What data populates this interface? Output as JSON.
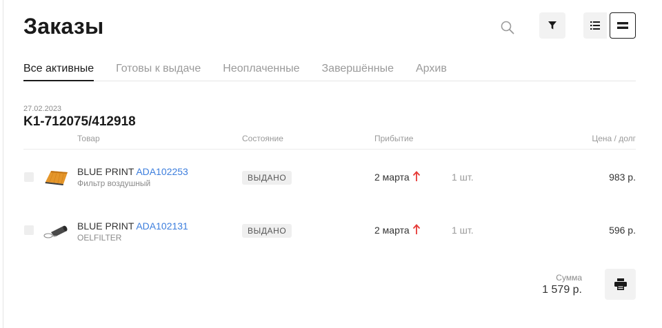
{
  "page": {
    "title": "Заказы"
  },
  "toolbar": {
    "search_icon": "search-icon",
    "filter_icon": "filter-icon",
    "list_view_icon": "list-view-icon",
    "compact_view_icon": "compact-view-icon"
  },
  "tabs": [
    {
      "label": "Все активные",
      "active": true
    },
    {
      "label": "Готовы к выдаче",
      "active": false
    },
    {
      "label": "Неоплаченные",
      "active": false
    },
    {
      "label": "Завершённые",
      "active": false
    },
    {
      "label": "Архив",
      "active": false
    }
  ],
  "order": {
    "date": "27.02.2023",
    "number": "K1-712075/412918",
    "columns": {
      "product": "Товар",
      "state": "Состояние",
      "arrival": "Прибытие",
      "price": "Цена / долг"
    },
    "items": [
      {
        "brand": "BLUE PRINT",
        "article": "ADA102253",
        "description": "Фильтр воздушный",
        "status": "ВЫДАНО",
        "arrival": "2 марта",
        "quantity": "1 шт.",
        "price": "983 р.",
        "thumb_icon": "air-filter-icon"
      },
      {
        "brand": "BLUE PRINT",
        "article": "ADA102131",
        "description": "OELFILTER",
        "status": "ВЫДАНО",
        "arrival": "2 марта",
        "quantity": "1 шт.",
        "price": "596 р.",
        "thumb_icon": "oil-filter-icon"
      }
    ],
    "total": {
      "label": "Сумма",
      "value": "1 579 р."
    }
  },
  "colors": {
    "accent_link": "#3b7ddd",
    "arrival_arrow": "#e53935",
    "text_primary": "#1a1a1a",
    "text_muted": "#9a9a9a"
  }
}
